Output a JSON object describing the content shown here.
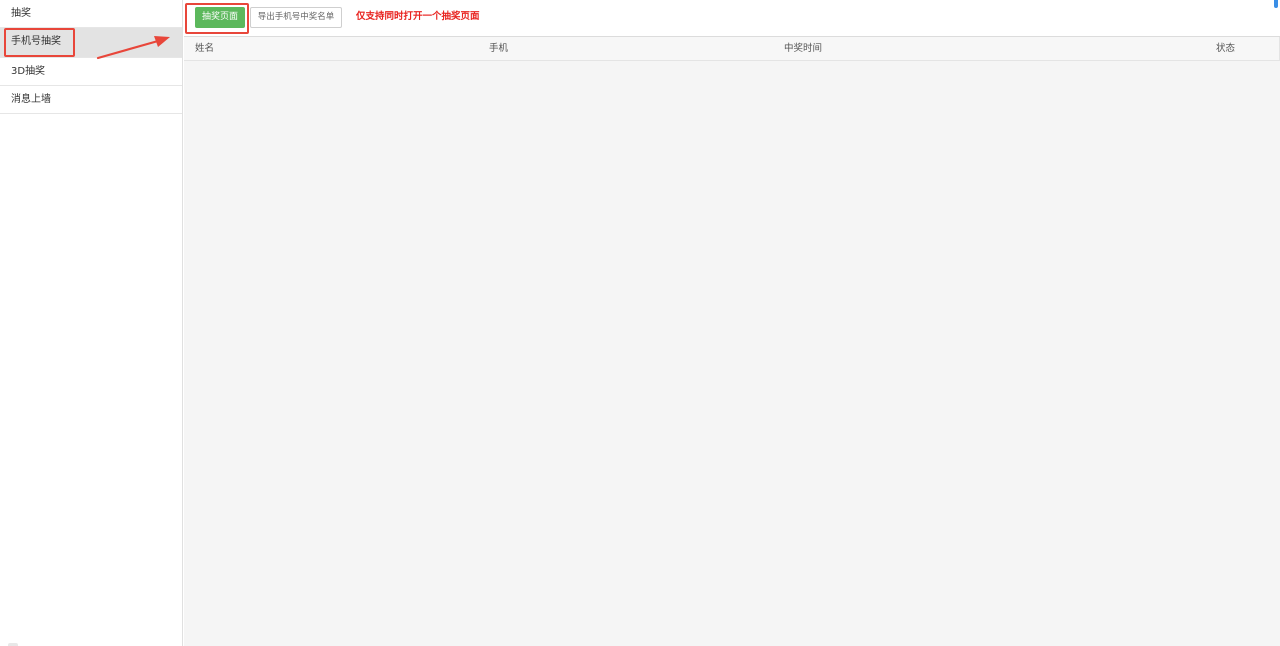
{
  "sidebar": {
    "items": [
      {
        "label": "抽奖",
        "active": false
      },
      {
        "label": "手机号抽奖",
        "active": true
      },
      {
        "label": "3D抽奖",
        "active": false
      },
      {
        "label": "消息上墙",
        "active": false
      }
    ]
  },
  "toolbar": {
    "lottery_page_button": "抽奖页面",
    "export_button": "导出手机号中奖名单",
    "notice": "仅支持同时打开一个抽奖页面"
  },
  "table": {
    "columns": [
      "姓名",
      "手机",
      "中奖时间",
      "状态"
    ],
    "rows": []
  },
  "colors": {
    "primary_button": "#5cb85c",
    "notice_text": "#e8231f",
    "annotation": "#e8463a",
    "active_sidebar": "#e3e3e3"
  }
}
